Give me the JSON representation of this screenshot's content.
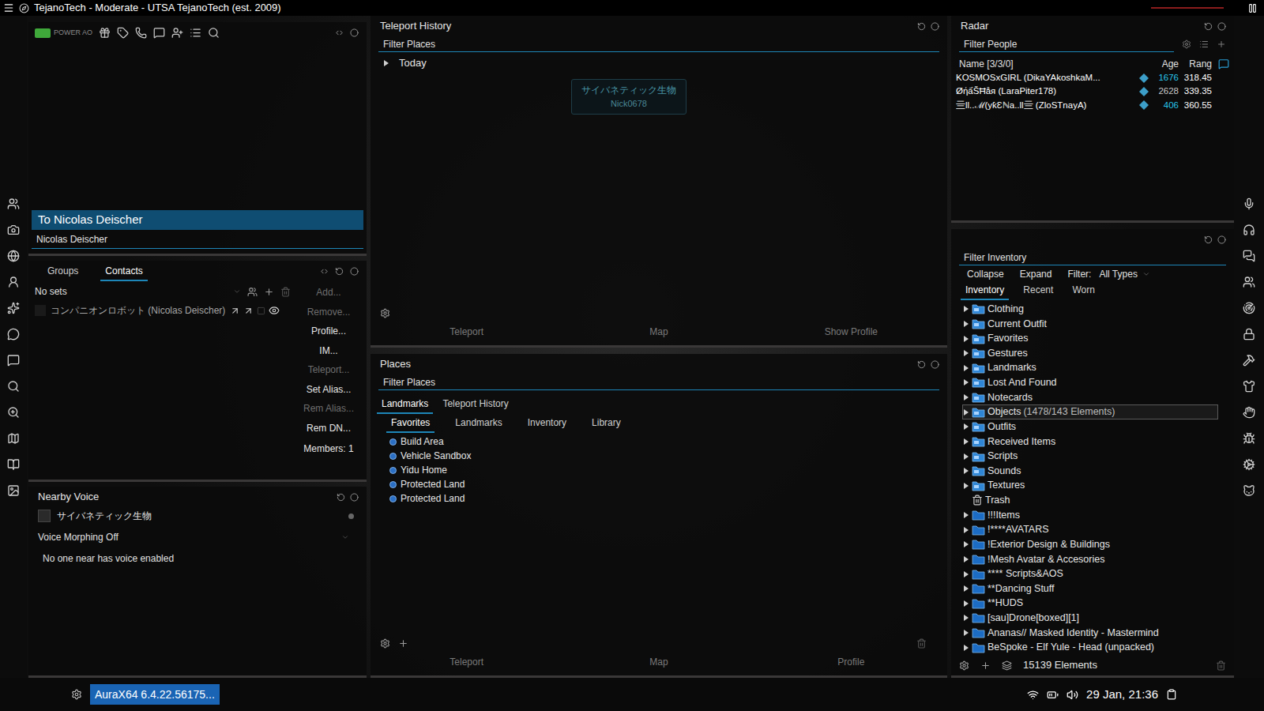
{
  "window": {
    "title": "TejanoTech - Moderate - UTSA TejanoTech (est. 2009)"
  },
  "chat_panel": {
    "power_ao": "POWER AO",
    "header": "To Nicolas Deischer",
    "recipient": "Nicolas Deischer"
  },
  "contacts": {
    "tabs": [
      {
        "label": "Groups",
        "selected": false
      },
      {
        "label": "Contacts",
        "selected": true
      }
    ],
    "sets": "No sets",
    "people": [
      {
        "name": "コンパニオンロボット (Nicolas Deischer)",
        "online": false
      }
    ],
    "actions": [
      {
        "label": "Add...",
        "disabled": true
      },
      {
        "label": "Remove...",
        "disabled": true
      },
      {
        "label": "Profile...",
        "disabled": false
      },
      {
        "label": "IM...",
        "disabled": false
      },
      {
        "label": "Teleport...",
        "disabled": true
      },
      {
        "label": "Set Alias...",
        "disabled": false
      },
      {
        "label": "Rem Alias...",
        "disabled": true
      },
      {
        "label": "Rem DN...",
        "disabled": false
      }
    ],
    "members": "Members: 1"
  },
  "nearby_voice": {
    "title": "Nearby Voice",
    "speakers": [
      {
        "name": "サイバネティック生物"
      }
    ],
    "morph": "Voice Morphing Off",
    "status": "No one near has voice enabled"
  },
  "teleport_history": {
    "title": "Teleport History",
    "filter_placeholder": "Filter Places",
    "groups": [
      {
        "label": "Today",
        "expanded": false
      }
    ],
    "buttons": [
      {
        "label": "Teleport",
        "disabled": true
      },
      {
        "label": "Map",
        "disabled": true
      },
      {
        "label": "Show Profile",
        "disabled": true
      }
    ]
  },
  "nametag": {
    "name": "サイバネティック生物",
    "user": "Nick0678"
  },
  "places": {
    "title": "Places",
    "filter_placeholder": "Filter Places",
    "tabs": [
      {
        "label": "Landmarks",
        "selected": true
      },
      {
        "label": "Teleport History",
        "selected": false
      }
    ],
    "subtabs": [
      {
        "label": "Favorites",
        "selected": true
      },
      {
        "label": "Landmarks",
        "selected": false
      },
      {
        "label": "Inventory",
        "selected": false
      },
      {
        "label": "Library",
        "selected": false
      }
    ],
    "items": [
      "Build Area",
      "Vehicle Sandbox",
      "Yidu Home",
      "Protected Land",
      "Protected Land"
    ],
    "buttons": [
      {
        "label": "Teleport",
        "disabled": true
      },
      {
        "label": "Map",
        "disabled": true
      },
      {
        "label": "Profile",
        "disabled": true
      }
    ]
  },
  "radar": {
    "title": "Radar",
    "filter_placeholder": "Filter People",
    "columns": [
      "Name [3/3/0]",
      "Age",
      "Rang"
    ],
    "rows": [
      {
        "name": "KOSMOSxGIRL (DikaYAkoshkaM...",
        "age": "1676",
        "range": "318.45",
        "color": "#27c4ea"
      },
      {
        "name": "ØήấŠĦåя (LaraPiter178)",
        "age": "2628",
        "range": "339.35",
        "color": "#c8c8c8"
      },
      {
        "name": "亖ll..ℳ(yƙƐℕa..ll亖 (ZloSTnayA)",
        "age": "406",
        "range": "360.55",
        "color": "#27c4ea"
      }
    ]
  },
  "inventory": {
    "filter_placeholder": "Filter Inventory",
    "collapse": "Collapse",
    "expand": "Expand",
    "filter_label": "Filter:",
    "filter_value": "All Types",
    "tabs": [
      {
        "label": "Inventory",
        "selected": true
      },
      {
        "label": "Recent",
        "selected": false
      },
      {
        "label": "Worn",
        "selected": false
      }
    ],
    "items": [
      {
        "name": "Clothing",
        "count": "",
        "kind": "system",
        "selected": false,
        "expanded": false
      },
      {
        "name": "Current Outfit",
        "count": "",
        "kind": "system",
        "selected": false,
        "expanded": false
      },
      {
        "name": "Favorites",
        "count": "",
        "kind": "system",
        "selected": false,
        "expanded": false
      },
      {
        "name": "Gestures",
        "count": "",
        "kind": "system",
        "selected": false,
        "expanded": false
      },
      {
        "name": "Landmarks",
        "count": "",
        "kind": "system",
        "selected": false,
        "expanded": false
      },
      {
        "name": "Lost And Found",
        "count": "",
        "kind": "system",
        "selected": false,
        "expanded": false
      },
      {
        "name": "Notecards",
        "count": "",
        "kind": "system",
        "selected": false,
        "expanded": false
      },
      {
        "name": "Objects",
        "count": "(1478/143 Elements)",
        "kind": "system",
        "selected": true,
        "expanded": false
      },
      {
        "name": "Outfits",
        "count": "",
        "kind": "system",
        "selected": false,
        "expanded": false
      },
      {
        "name": "Received Items",
        "count": "",
        "kind": "system",
        "selected": false,
        "expanded": false
      },
      {
        "name": "Scripts",
        "count": "",
        "kind": "system",
        "selected": false,
        "expanded": false
      },
      {
        "name": "Sounds",
        "count": "",
        "kind": "system",
        "selected": false,
        "expanded": false
      },
      {
        "name": "Textures",
        "count": "",
        "kind": "system",
        "selected": false,
        "expanded": false
      },
      {
        "name": "Trash",
        "count": "",
        "kind": "trash",
        "selected": false,
        "expanded": false
      },
      {
        "name": "!!!Items",
        "count": "",
        "kind": "user",
        "selected": false,
        "expanded": false
      },
      {
        "name": "!****AVATARS",
        "count": "",
        "kind": "user",
        "selected": false,
        "expanded": false
      },
      {
        "name": "!Exterior Design & Buildings",
        "count": "",
        "kind": "user",
        "selected": false,
        "expanded": false
      },
      {
        "name": "!Mesh Avatar & Accesories",
        "count": "",
        "kind": "user",
        "selected": false,
        "expanded": false
      },
      {
        "name": "**** Scripts&AOS",
        "count": "",
        "kind": "user",
        "selected": false,
        "expanded": false
      },
      {
        "name": "**Dancing Stuff",
        "count": "",
        "kind": "user",
        "selected": false,
        "expanded": false
      },
      {
        "name": "**HUDS",
        "count": "",
        "kind": "user",
        "selected": false,
        "expanded": false
      },
      {
        "name": "[sau]Drone[boxed][1]",
        "count": "",
        "kind": "user",
        "selected": false,
        "expanded": false
      },
      {
        "name": "Ananas// Masked Identity - Mastermind",
        "count": "",
        "kind": "user",
        "selected": false,
        "expanded": false
      },
      {
        "name": "BeSpoke - Elf Yule - Head (unpacked)",
        "count": "",
        "kind": "user",
        "selected": false,
        "expanded": false
      }
    ],
    "footer": "15139 Elements"
  },
  "taskbar": {
    "app": "AuraX64 6.4.22.56175...",
    "clock": "29 Jan, 21:36"
  }
}
